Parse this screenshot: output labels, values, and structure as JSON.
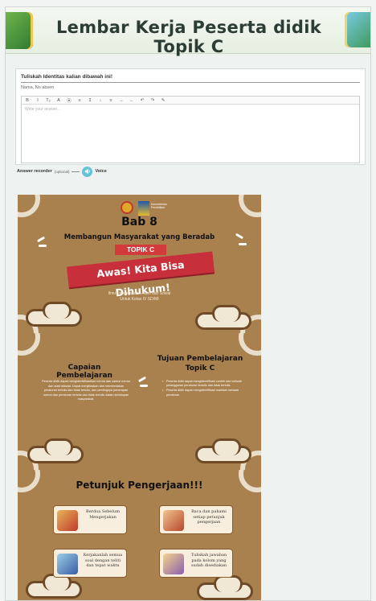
{
  "page": {
    "title": "Lembar Kerja Peserta didik Topik C"
  },
  "question": {
    "title": "Tuliskah Identitas kalian dibawah ini!",
    "subtitle": "Nama, No absen",
    "editor_placeholder": "Write your answer...",
    "toolbar": [
      "B",
      "I",
      "T₂",
      "A",
      "⦿",
      "≡",
      "↧",
      "↓",
      "≡",
      "→",
      "←",
      "↶",
      "↷",
      "✎"
    ]
  },
  "recorder": {
    "label": "Answer recorder",
    "optional": "(optional)",
    "voice_label": "Voice"
  },
  "slide1": {
    "logo_text": "Kementerian Pendidikan",
    "bab": "Bab 8",
    "subtitle": "Membangun Masyarakat yang Beradab",
    "topik": "TOPIK C",
    "ribbon": "Awas! Kita Bisa Dihukum!",
    "buku_line1": "Ilmu Pengetahuan Alam dan Sosial",
    "buku_line2": "Untuk Kelas IV SD/MI"
  },
  "slide2": {
    "capaian_title": "Capaian Pembelajaran",
    "capaian_text": "Peserta didik dapat mengidentifikasikan norma dan sanksi norma dan adat istiadat. Dapat menjelaskan dan membedakan peraturan tertulis dan tidak tertulis, dan pentingnya penerapan norma dan peraturan tertulis dan tidak tertulis dalam kehidupan masyarakat.",
    "tujuan_title": "Tujuan Pembelajaran Topik C",
    "tujuan_items": [
      "Peserta didik dapat mengidentifikasi contoh dari sebuah pelanggaran peraturan tertulis dan tidak tertulis.",
      "Peserta didik dapat mengidentifikasi manfaat menaati peraturan."
    ]
  },
  "slide3": {
    "title": "Petunjuk Pengerjaan!!!",
    "steps": [
      {
        "text": "Berdoa Sebelum Mengerjakan"
      },
      {
        "text": "Baca dan pahami setiap petunjuk pengerjaan"
      },
      {
        "text": "Kerjakanlah semua soal dengan teliti dan tepat waktu"
      },
      {
        "text": "Tuliskah jawaban pada kolom yang sudah disediakan"
      }
    ]
  },
  "colors": {
    "slide_bg": "#a9814f",
    "ribbon": "#c7303a",
    "voice": "#67c2d8"
  }
}
